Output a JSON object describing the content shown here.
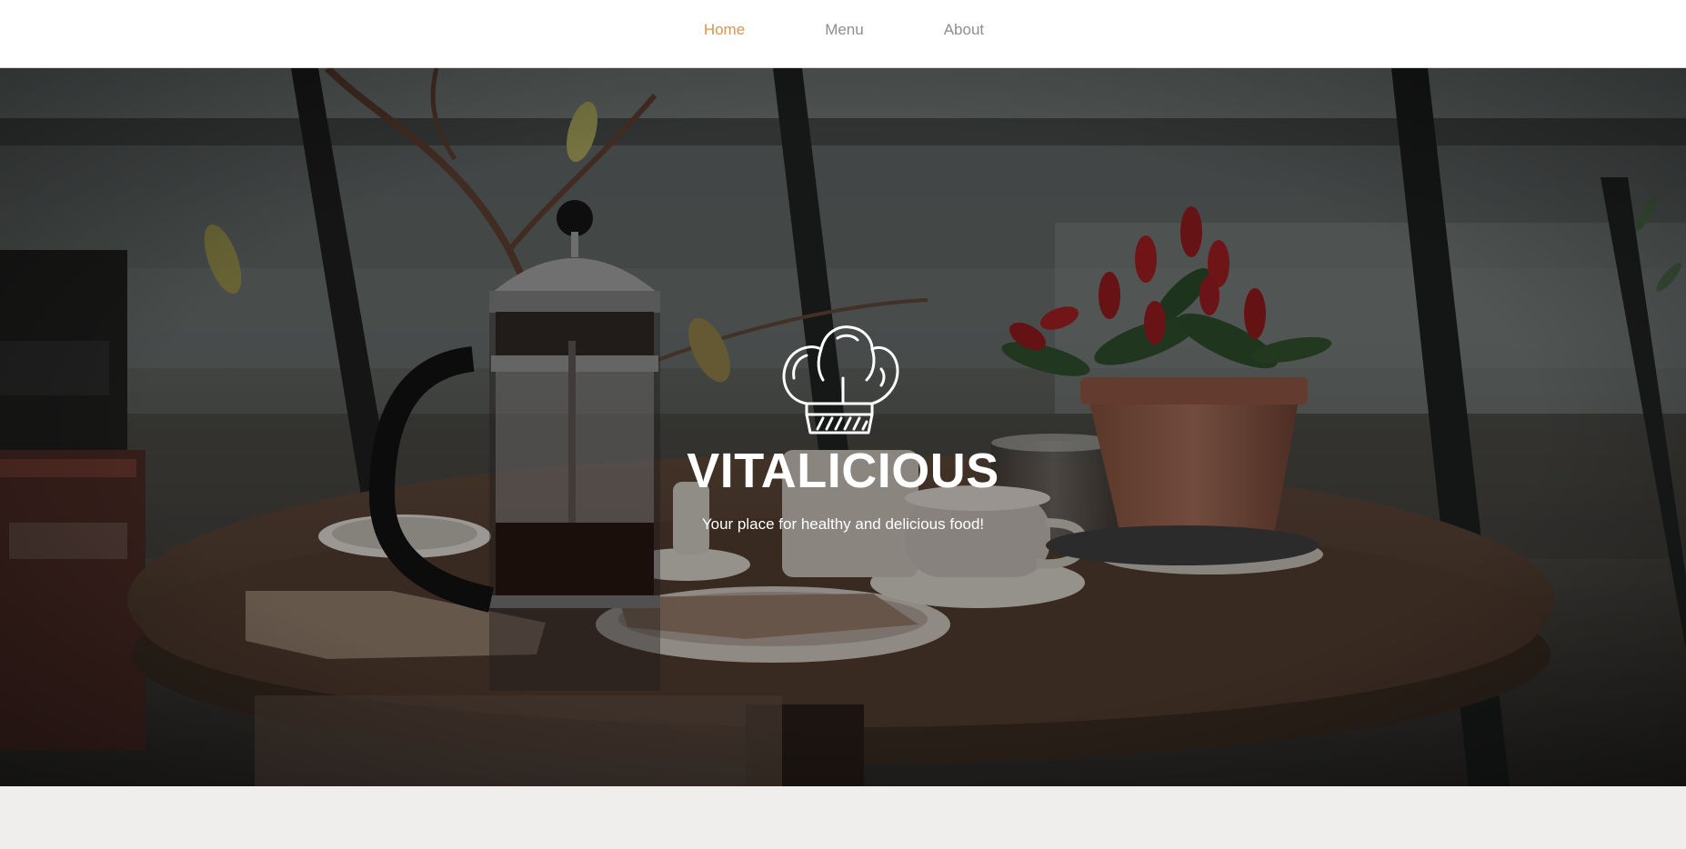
{
  "nav": {
    "items": [
      {
        "label": "Home",
        "active": true
      },
      {
        "label": "Menu",
        "active": false
      },
      {
        "label": "About",
        "active": false
      }
    ]
  },
  "hero": {
    "title": "VITALICIOUS",
    "tagline": "Your place for healthy and delicious food!",
    "icon": "chef-hat-icon"
  },
  "colors": {
    "nav_active": "#d9964f",
    "nav_inactive": "#8e8e8e",
    "page_background": "#efeeec",
    "hero_text": "#ffffff"
  }
}
